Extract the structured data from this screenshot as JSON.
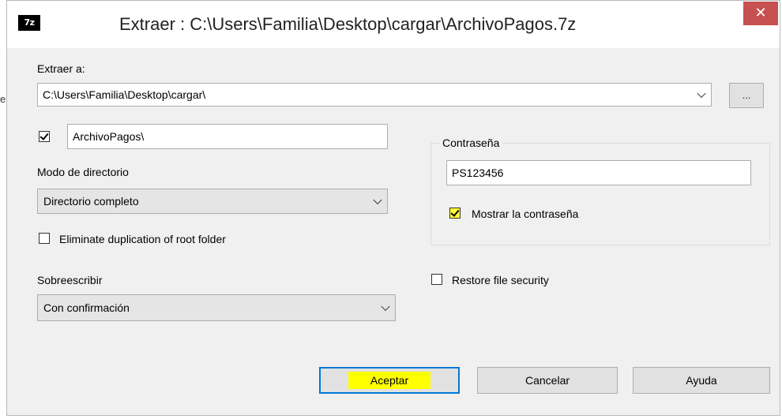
{
  "window": {
    "app_icon": "7z",
    "title": "Extraer : C:\\Users\\Familia\\Desktop\\cargar\\ArchivoPagos.7z",
    "close_symbol": "✕"
  },
  "extract_to": {
    "label": "Extraer a:",
    "path_value": "C:\\Users\\Familia\\Desktop\\cargar\\",
    "browse_label": "..."
  },
  "subfolder": {
    "checked": true,
    "value": "ArchivoPagos\\"
  },
  "path_mode": {
    "label": "Modo de directorio",
    "selected": "Directorio completo"
  },
  "eliminate_dup": {
    "checked": false,
    "label": "Eliminate duplication of root folder"
  },
  "overwrite": {
    "label": "Sobreescribir",
    "selected": "Con confirmación"
  },
  "password": {
    "group_label": "Contraseña",
    "value": "PS123456",
    "show_checked": true,
    "show_label": "Mostrar la contraseña"
  },
  "restore_security": {
    "checked": false,
    "label": "Restore file security"
  },
  "buttons": {
    "ok": "Aceptar",
    "cancel": "Cancelar",
    "help": "Ayuda"
  },
  "highlight_color": "#ffff00"
}
